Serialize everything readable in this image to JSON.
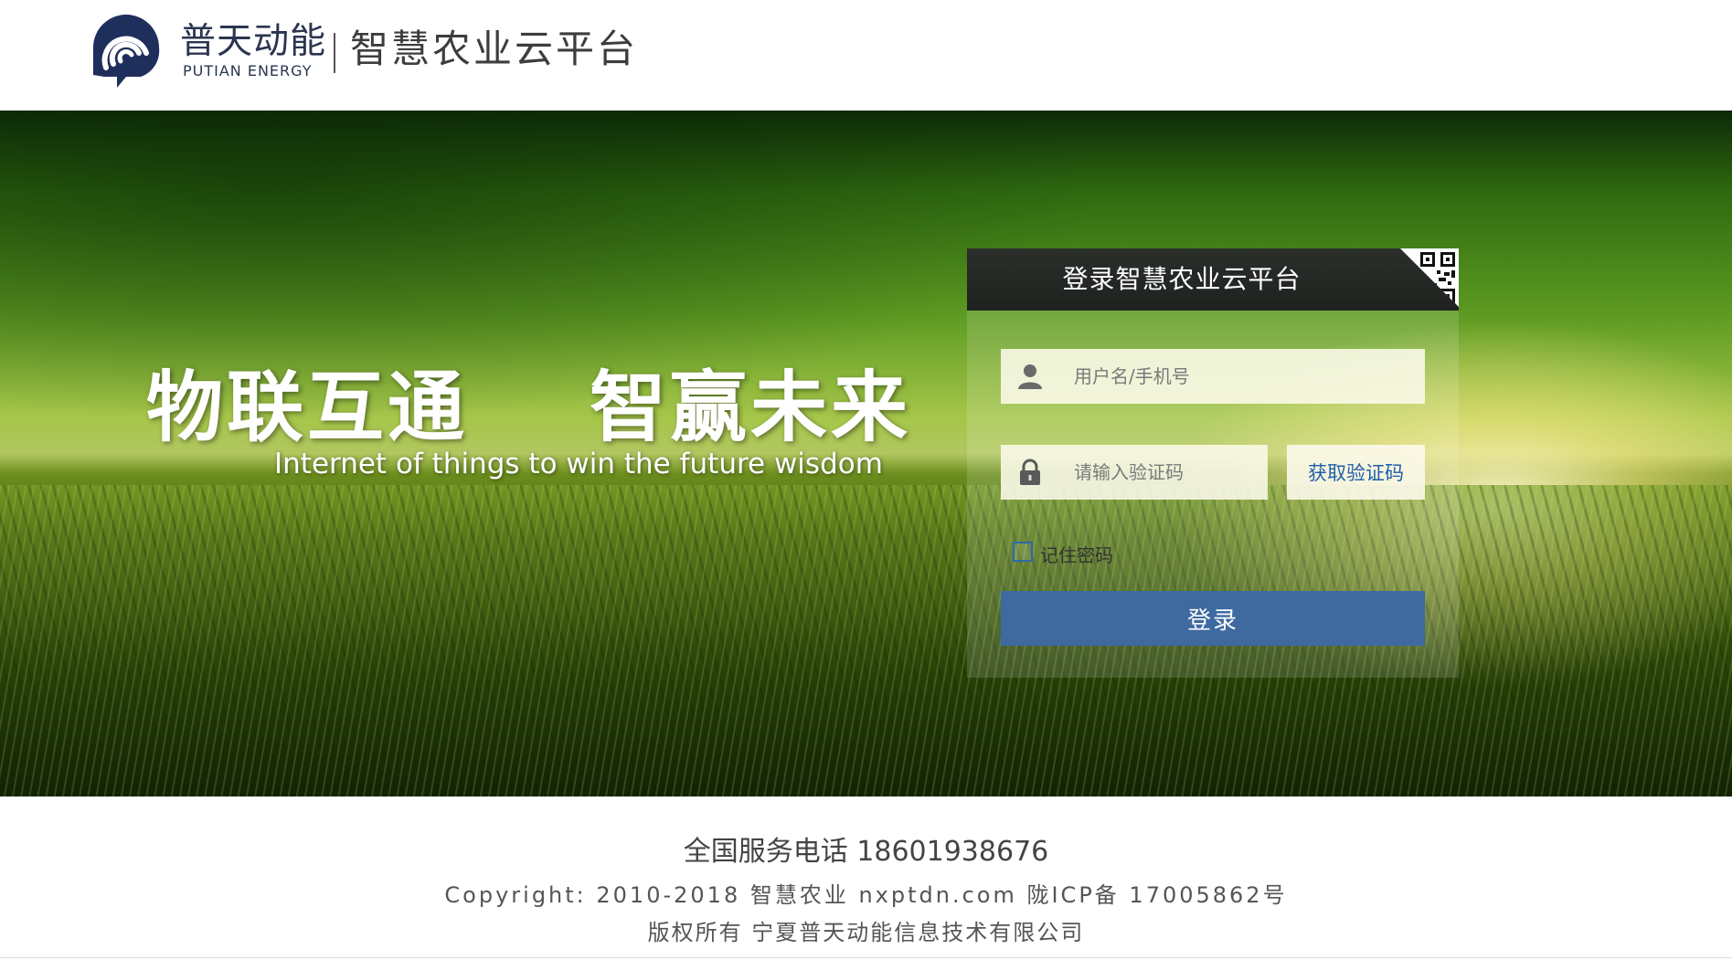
{
  "header": {
    "brand_cn": "普天动能",
    "brand_en": "PUTIAN ENERGY",
    "platform_title": "智慧农业云平台",
    "logo_icon": "putian-logo-icon",
    "brand_color": "#1f2f5c"
  },
  "banner": {
    "slogan_cn": "物联互通    智赢未来",
    "slogan_en": "Internet of things to win the future wisdom"
  },
  "login": {
    "title": "登录智慧农业云平台",
    "qr_icon": "qr-code-icon",
    "username_placeholder": "用户名/手机号",
    "username_icon": "user-icon",
    "code_placeholder": "请输入验证码",
    "code_icon": "lock-icon",
    "get_code_label": "获取验证码",
    "remember_label": "记住密码",
    "remember_checked": false,
    "submit_label": "登录",
    "accent_color": "#3e6aa0"
  },
  "footer": {
    "service_phone": "全国服务电话 18601938676",
    "copyright": "Copyright:  2010-2018 智慧农业 nxptdn.com 陇ICP备 17005862号",
    "owner": "版权所有 宁夏普天动能信息技术有限公司"
  }
}
